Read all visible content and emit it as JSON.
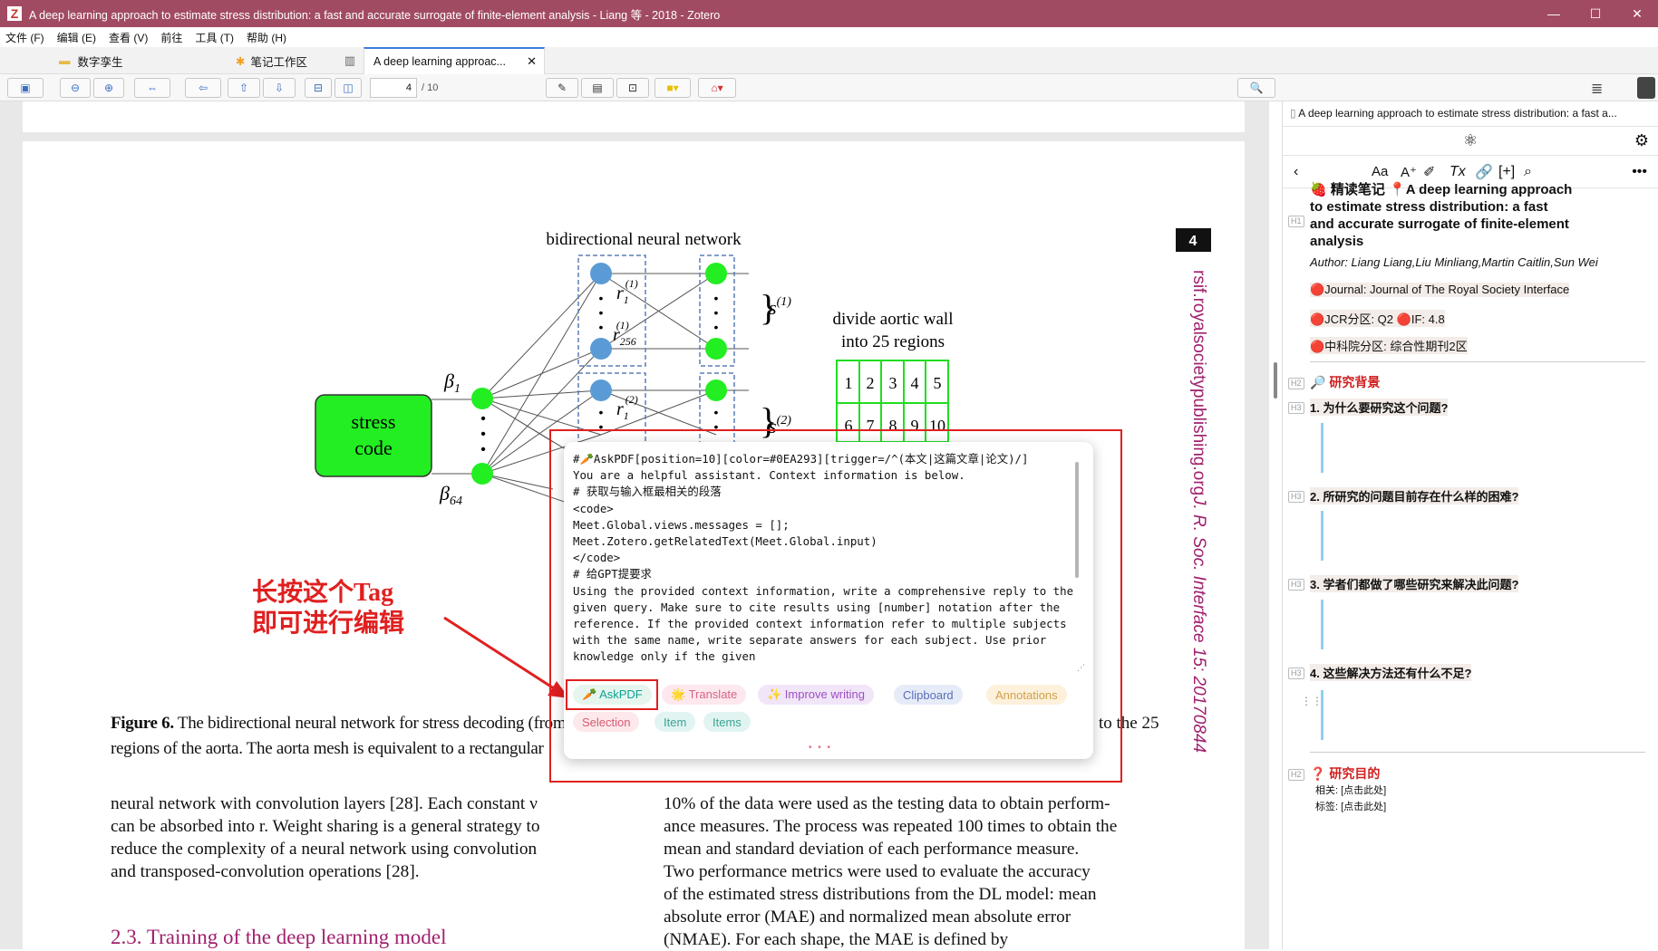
{
  "window": {
    "title": "A deep learning approach to estimate stress distribution: a fast and accurate surrogate of finite-element analysis - Liang 等 - 2018 - Zotero",
    "logo": "Z"
  },
  "menu": [
    "文件 (F)",
    "编辑 (E)",
    "查看 (V)",
    "前往",
    "工具 (T)",
    "帮助 (H)"
  ],
  "tabs": [
    {
      "label": "数字孪生"
    },
    {
      "label": "笔记工作区"
    },
    {
      "label": "A deep learning approac..."
    }
  ],
  "toolbar": {
    "page": "4",
    "page_total": "/ 10"
  },
  "pdf": {
    "figure_title": "bidirectional neural network",
    "stress_code": "stress\ncode",
    "divide_label": "divide aortic wall\ninto 25 regions",
    "grid": [
      "1",
      "2",
      "3",
      "4",
      "5",
      "6",
      "7",
      "8",
      "9",
      "10"
    ],
    "page_number": "4",
    "side_journal": "rsif.royalsocietypublishing.org",
    "side_citation": "J. R. Soc. Interface 15: 20170844",
    "caption_line1_bold": "Figure 6.",
    "caption_line1": "The bidirectional neural network for stress decoding (from le",
    "caption_line1_end": "to the 25",
    "caption_line2": "regions of the aorta. The aorta mesh is equivalent to a rectangular",
    "annotation": "长按这个Tag\n即可进行编辑",
    "col1": "neural network with convolution layers [28]. Each constant ν\ncan be absorbed into r. Weight sharing is a general strategy to\nreduce the complexity of a neural network using convolution\nand transposed-convolution operations [28].",
    "col2": "10% of the data were used as the testing data to obtain perform-\nance measures. The process was repeated 100 times to obtain the\nmean and standard deviation of each performance measure.\n    Two performance metrics were used to evaluate the accuracy\nof the estimated stress distributions from the DL model: mean\nabsolute error (MAE) and normalized mean absolute error\n(NMAE). For each shape, the MAE is defined by",
    "section": "2.3. Training of the deep learning model"
  },
  "popup": {
    "code": "#🥕AskPDF[position=10][color=#0EA293][trigger=/^(本文|这篇文章|论文)/]\nYou are a helpful assistant. Context information is below.\n# 获取与输入框最相关的段落\n<code>\nMeet.Global.views.messages = [];\nMeet.Zotero.getRelatedText(Meet.Global.input)\n</code>\n# 给GPT提要求\nUsing the provided context information, write a comprehensive reply to the given query. Make sure to cite results using [number] notation after the reference. If the provided context information refer to multiple subjects with the same name, write separate answers for each subject. Use prior knowledge only if the given",
    "tags": [
      {
        "label": "🥕 AskPDF",
        "bg": "#e6f6ef",
        "fg": "#0EA293"
      },
      {
        "label": "🌟 Translate",
        "bg": "#fde8ee",
        "fg": "#d76587"
      },
      {
        "label": "✨ Improve writing",
        "bg": "#f1e5f8",
        "fg": "#9c4fc2"
      },
      {
        "label": "Clipboard",
        "bg": "#e6ebf8",
        "fg": "#5a6fb8"
      },
      {
        "label": "Annotations",
        "bg": "#fdf1dc",
        "fg": "#d2a04a"
      },
      {
        "label": "Selection",
        "bg": "#fde8ec",
        "fg": "#d45b72"
      },
      {
        "label": "Item",
        "bg": "#e1f4f1",
        "fg": "#3aa394"
      },
      {
        "label": "Items",
        "bg": "#e1f4f1",
        "fg": "#3aa394"
      }
    ],
    "more": "• • •"
  },
  "note": {
    "header": "A deep learning approach to estimate stress distribution: a fast a...",
    "h1": "🍓 精读笔记  📍A deep learning approach to estimate stress distribution: a fast and accurate surrogate of finite-element analysis",
    "author": "Author: Liang Liang,Liu Minliang,Martin Caitlin,Sun Wei",
    "journal": "🔴Journal: Journal of The Royal Society Interface",
    "jcr": "🔴JCR分区: Q2 🔴IF: 4.8",
    "cas": "🔴中科院分区: 综合性期刊2区",
    "h2_bg": "🔎 研究背景",
    "q1": "1. 为什么要研究这个问题?",
    "q2": "2. 所研究的问题目前存在什么样的困难?",
    "q3": "3. 学者们都做了哪些研究来解决此问题?",
    "q4": "4. 这些解决方法还有什么不足?",
    "h2_goal": "❓ 研究目的",
    "rel": "相关: [点击此处]",
    "tag": "标签: [点击此处]"
  },
  "colors": {
    "titlebar": "#a14b62",
    "annotation": "#e02020",
    "node": "#22ee22",
    "nodeblue": "#5b9bd5",
    "journal": "#a0206e"
  }
}
